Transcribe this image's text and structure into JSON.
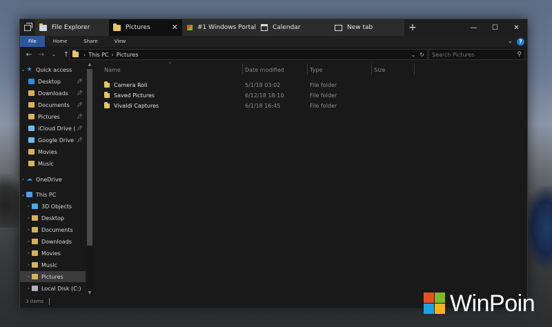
{
  "window": {
    "tabs": [
      {
        "label": "File Explorer",
        "icon": "folder-icon"
      },
      {
        "label": "Pictures",
        "icon": "pictures-folder-icon"
      },
      {
        "label": "#1 Windows Portal I",
        "icon": "winpoin-favicon-icon"
      },
      {
        "label": "Calendar",
        "icon": "calendar-icon"
      },
      {
        "label": "New tab",
        "icon": "new-tab-icon"
      }
    ],
    "add_tab_glyph": "+",
    "caption": {
      "minimize": "—",
      "maximize": "☐",
      "close": "✕"
    }
  },
  "ribbon": {
    "tabs": [
      "File",
      "Home",
      "Share",
      "View"
    ],
    "help_glyph": "?"
  },
  "address_bar": {
    "crumbs": [
      "This PC",
      "Pictures"
    ],
    "search_placeholder": "Search Pictures"
  },
  "nav_pane": {
    "quick_access_label": "Quick access",
    "quick_access_items": [
      {
        "label": "Desktop",
        "pinned": true
      },
      {
        "label": "Downloads",
        "pinned": true
      },
      {
        "label": "Documents",
        "pinned": true
      },
      {
        "label": "Pictures",
        "pinned": true
      },
      {
        "label": "iCloud Drive (",
        "pinned": true
      },
      {
        "label": "Google Drive",
        "pinned": true
      },
      {
        "label": "Movies",
        "pinned": false
      },
      {
        "label": "Music",
        "pinned": false
      }
    ],
    "onedrive_label": "OneDrive",
    "this_pc_label": "This PC",
    "this_pc_items": [
      "3D Objects",
      "Desktop",
      "Documents",
      "Downloads",
      "Movies",
      "Music",
      "Pictures",
      "Local Disk (C:)"
    ],
    "selected_item": "Pictures"
  },
  "content": {
    "columns": [
      "Name",
      "Date modified",
      "Type",
      "Size"
    ],
    "files": [
      {
        "name": "Camera Roll",
        "date": "5/1/18 03:02",
        "type": "File folder"
      },
      {
        "name": "Saved Pictures",
        "date": "6/12/18 18:10",
        "type": "File folder"
      },
      {
        "name": "Vivaldi Captures",
        "date": "6/1/18 16:45",
        "type": "File folder"
      }
    ]
  },
  "status": {
    "item_count": "3 items"
  },
  "watermark": {
    "text": "WinPoin"
  },
  "colors": {
    "accent": "#2b579a",
    "folder": "#e8c560",
    "window_bg": "#191919"
  }
}
